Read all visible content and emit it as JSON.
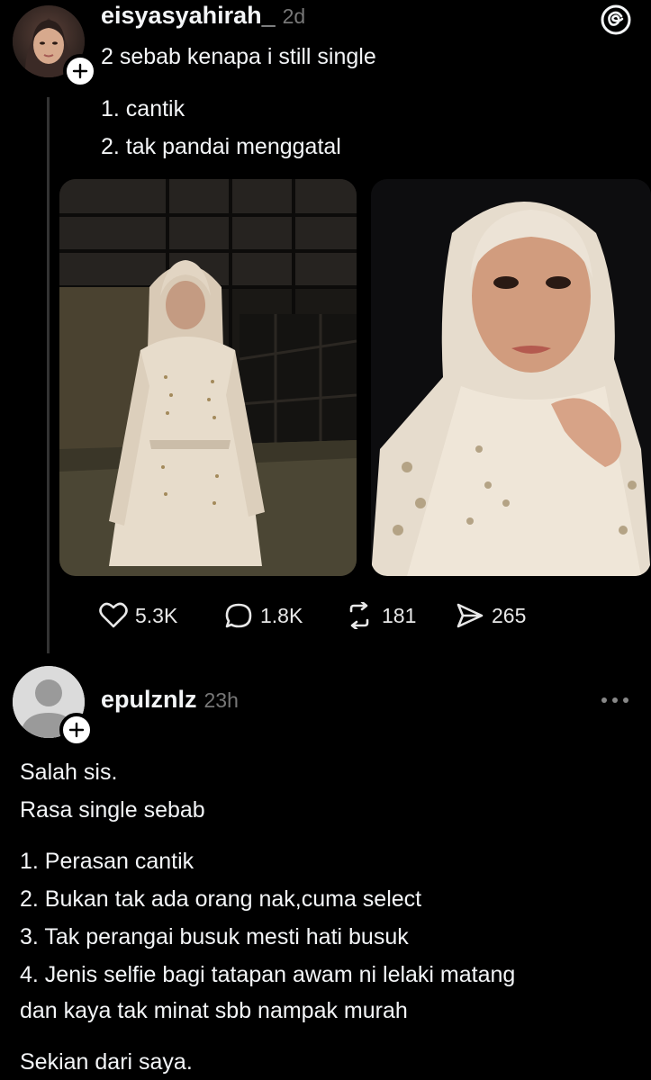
{
  "post": {
    "username": "eisyasyahirah_",
    "time": "2d",
    "lines": [
      "2 sebab kenapa i still single",
      "1. cantik",
      "2. tak pandai menggatal"
    ],
    "stats": {
      "likes": "5.3K",
      "replies": "1.8K",
      "reposts": "181",
      "shares": "265"
    }
  },
  "reply": {
    "username": "epulznlz",
    "time": "23h",
    "lines": [
      "Salah sis.",
      "Rasa single sebab",
      "1. Perasan cantik",
      "2. Bukan tak ada orang nak,cuma select",
      "3. Tak perangai busuk mesti hati busuk",
      "4. Jenis selfie bagi tatapan awam ni lelaki matang",
      "dan kaya tak minat sbb nampak murah",
      "Sekian dari saya."
    ]
  },
  "icons": {
    "app_logo": "threads-logo-icon",
    "more": "more-options-icon"
  },
  "colors": {
    "background": "#000000",
    "text": "#f3f5f7",
    "muted": "#777777",
    "thread_line": "#333333"
  }
}
